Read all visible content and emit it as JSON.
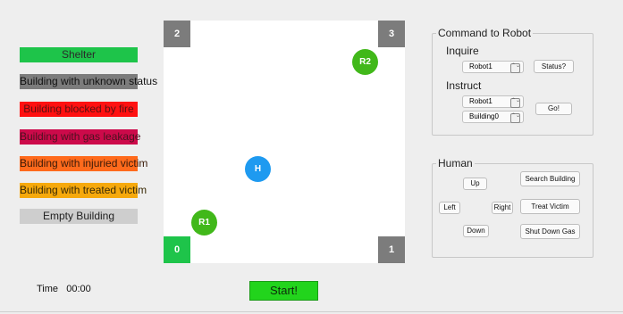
{
  "legend": [
    {
      "label": "Shelter",
      "bg": "#1ec44a",
      "color": "#2a2a2a"
    },
    {
      "label": "Building with unknown status",
      "bg": "#7c7c7c",
      "color": "#111111"
    },
    {
      "label": "Building blocked by fire",
      "bg": "#ff1111",
      "color": "#5a1212"
    },
    {
      "label": "Building with gas leakage",
      "bg": "#cc0a4a",
      "color": "#4a1220"
    },
    {
      "label": "Building with injuried victim",
      "bg": "#ff6a1c",
      "color": "#3a1a08"
    },
    {
      "label": "Building with treated victim",
      "bg": "#f6a90c",
      "color": "#3a2a06"
    },
    {
      "label": "Empty Building",
      "bg": "#cecece",
      "color": "#222222"
    }
  ],
  "map": {
    "corners": {
      "tl": "2",
      "tr": "3",
      "bl": "0",
      "br": "1"
    },
    "colors": {
      "gray": "#7c7c7c",
      "shelter": "#1ec44a"
    },
    "robots": [
      {
        "label": "R1",
        "color": "#41b81a"
      },
      {
        "label": "R2",
        "color": "#41b81a"
      }
    ],
    "human": {
      "label": "H",
      "color": "#1e9af0"
    }
  },
  "command": {
    "title": "Command to Robot",
    "inquire_label": "Inquire",
    "inquire_robot": "Robot1",
    "status_button": "Status?",
    "instruct_label": "Instruct",
    "instruct_robot": "Robot1",
    "instruct_building": "Building0",
    "go_button": "Go!"
  },
  "human_panel": {
    "title": "Human",
    "up": "Up",
    "down": "Down",
    "left": "Left",
    "right": "Right",
    "search": "Search Building",
    "treat": "Treat Victim",
    "shutdown": "Shut Down Gas"
  },
  "time": {
    "label": "Time",
    "value": "00:00"
  },
  "start_button": "Start!",
  "start_color": "#22d41c"
}
